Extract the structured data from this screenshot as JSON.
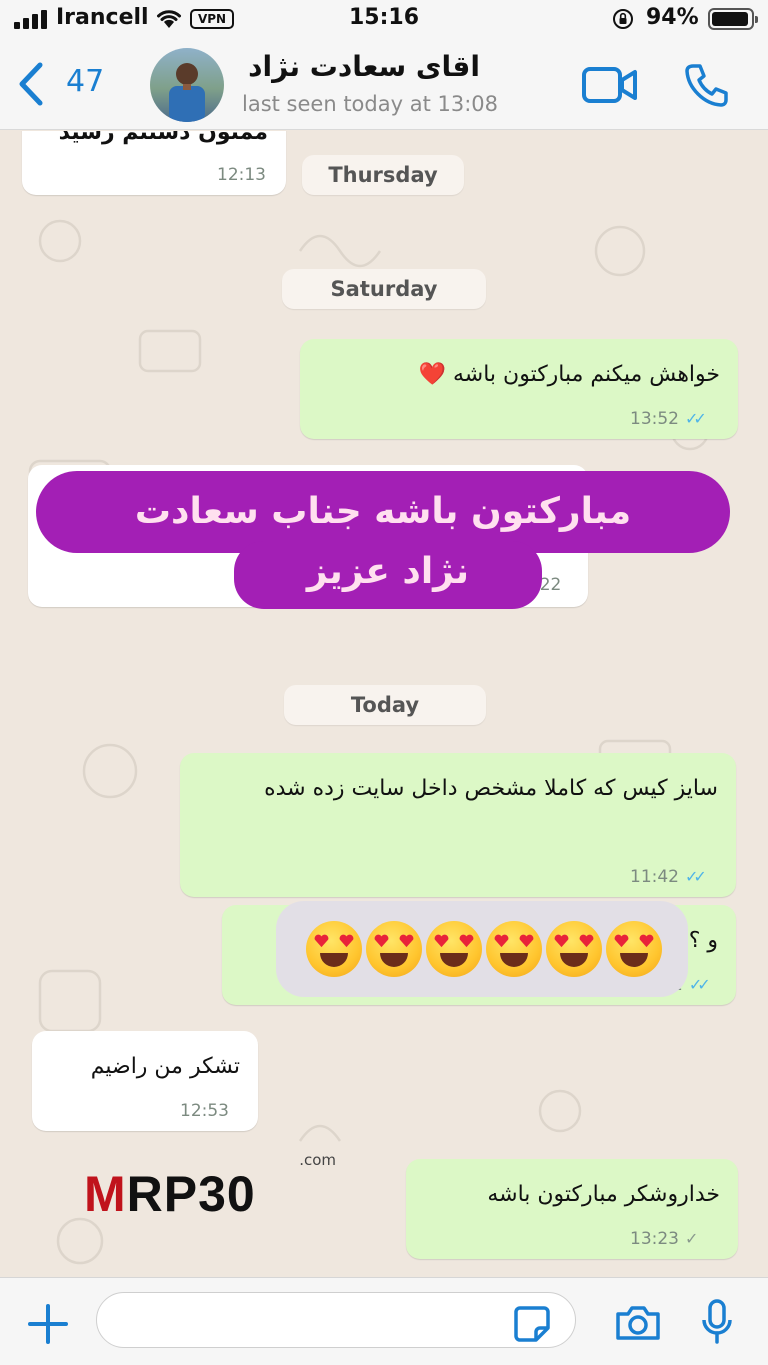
{
  "status_bar": {
    "carrier": "Irancell",
    "vpn_label": "VPN",
    "time": "15:16",
    "battery_text": "94%",
    "battery_level": 0.94
  },
  "header": {
    "back_count": "47",
    "contact_name": "اقای سعادت نژاد",
    "last_seen": "last seen today at 13:08"
  },
  "chat": {
    "cut_off_message": {
      "text": "ممنون دستتم رسید",
      "time": "12:13"
    },
    "day_separators": {
      "thursday": "Thursday",
      "saturday": "Saturday",
      "today": "Today"
    },
    "messages": [
      {
        "direction": "outgoing",
        "text": "خواهش میکنم مبارکتون باشه ❤️",
        "time": "13:52",
        "status": "read"
      },
      {
        "direction": "incoming",
        "text": "",
        "time": ":22"
      },
      {
        "direction": "outgoing",
        "text": "سایز کیس که کاملا مشخص داخل سایت زده شده",
        "time": "11:42",
        "status": "read"
      },
      {
        "direction": "outgoing",
        "text": "و ؟",
        "time": "2",
        "status": "read"
      },
      {
        "direction": "incoming",
        "text": "تشکر من راضیم",
        "time": "12:53"
      },
      {
        "direction": "outgoing",
        "text": "خداروشکر مبارکتون باشه",
        "time": "13:23",
        "status": "sent"
      }
    ]
  },
  "overlays": {
    "banner_line1": "مبارکتون باشه جناب سعادت",
    "banner_line2": "نژاد عزیز",
    "emoji_count": 6,
    "emoji_name": "smiling-face-with-heart-eyes"
  },
  "watermark": {
    "part_red": "M",
    "part_black_1": "R",
    "part_red_2": "P",
    "part_black_2": "30",
    "domain": ".com"
  },
  "input": {
    "placeholder": ""
  },
  "colors": {
    "accent": "#1a7fd1",
    "outgoing_bubble": "#dcf8c6",
    "incoming_bubble": "#ffffff",
    "chat_background": "#efe7de",
    "banner": "#a31fb5",
    "read_ticks": "#4fb4e8",
    "watermark_red": "#c0131c"
  }
}
